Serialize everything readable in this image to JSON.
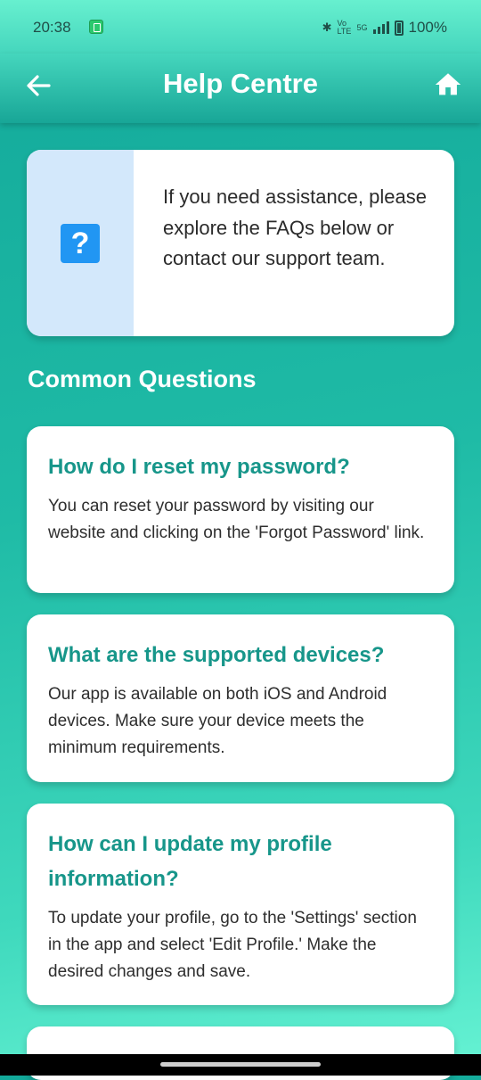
{
  "status_bar": {
    "time": "20:38",
    "network_label": "Vo LTE",
    "network_type": "5G",
    "battery": "100%"
  },
  "app_bar": {
    "title": "Help Centre",
    "back_icon": "back-arrow-icon",
    "home_icon": "home-icon"
  },
  "info_card": {
    "icon": "question-icon",
    "icon_glyph": "?",
    "text": "If you need assistance, please explore the FAQs below or contact our support team."
  },
  "section": {
    "title": "Common Questions"
  },
  "faqs": [
    {
      "question": "How do I reset my password?",
      "answer": "You can reset your password by visiting our website and clicking on the 'Forgot Password' link."
    },
    {
      "question": "What are the supported devices?",
      "answer": "Our app is available on both iOS and Android devices. Make sure your device meets the minimum requirements."
    },
    {
      "question": "How can I update my profile information?",
      "answer": "To update your profile, go to the 'Settings' section in the app and select 'Edit Profile.' Make the desired changes and save."
    }
  ],
  "colors": {
    "accent": "#17968a",
    "app_bar_top": "#45d6bd",
    "app_bar_bottom": "#18a697",
    "info_panel": "#d3e8fb",
    "info_icon": "#2196f3"
  }
}
